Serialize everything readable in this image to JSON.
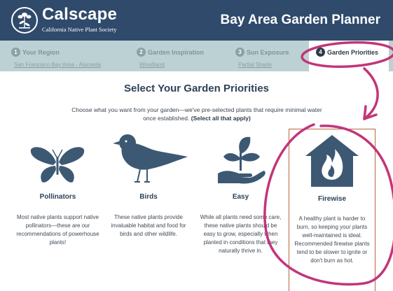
{
  "header": {
    "brand": "Calscape",
    "brand_subtitle": "California Native Plant Society",
    "app_title": "Bay Area Garden Planner"
  },
  "steps": [
    {
      "number": "1",
      "title": "Your Region",
      "value": "San Francisco Bay Area - Alameda"
    },
    {
      "number": "2",
      "title": "Garden Inspiration",
      "value": "Woodland"
    },
    {
      "number": "3",
      "title": "Sun Exposure",
      "value": "Partial Shade"
    },
    {
      "number": "4",
      "title": "Garden Priorities",
      "value": ""
    }
  ],
  "main": {
    "heading": "Select Your Garden Priorities",
    "intro": "Choose what you want from your garden—we've pre-selected plants that require minimal water once established.",
    "intro_bold": "(Select all that apply)"
  },
  "priorities": [
    {
      "title": "Pollinators",
      "icon": "butterfly-icon",
      "description": "Most native plants support native pollinators—these are our recommendations of powerhouse plants!",
      "selected": false
    },
    {
      "title": "Birds",
      "icon": "bird-icon",
      "description": "These native plants provide invaluable habitat and food for birds and other wildlife.",
      "selected": false
    },
    {
      "title": "Easy",
      "icon": "hand-plant-icon",
      "description": "While all plants need some care, these native plants should be easy to grow, especially when planted in conditions that they naturally thrive in.",
      "selected": false
    },
    {
      "title": "Firewise",
      "icon": "fire-house-icon",
      "description": "A healthy plant is harder to burn, so keeping your plants well-maintained is ideal. Recommended firewise plants tend to be slower to ignite or don't burn as hot.",
      "selected": true
    }
  ],
  "colors": {
    "header_bg": "#2f4a6b",
    "steps_bg": "#bcd1d3",
    "icon": "#3d5873",
    "selected_border": "#b9643c",
    "annotation": "#c2357a"
  }
}
